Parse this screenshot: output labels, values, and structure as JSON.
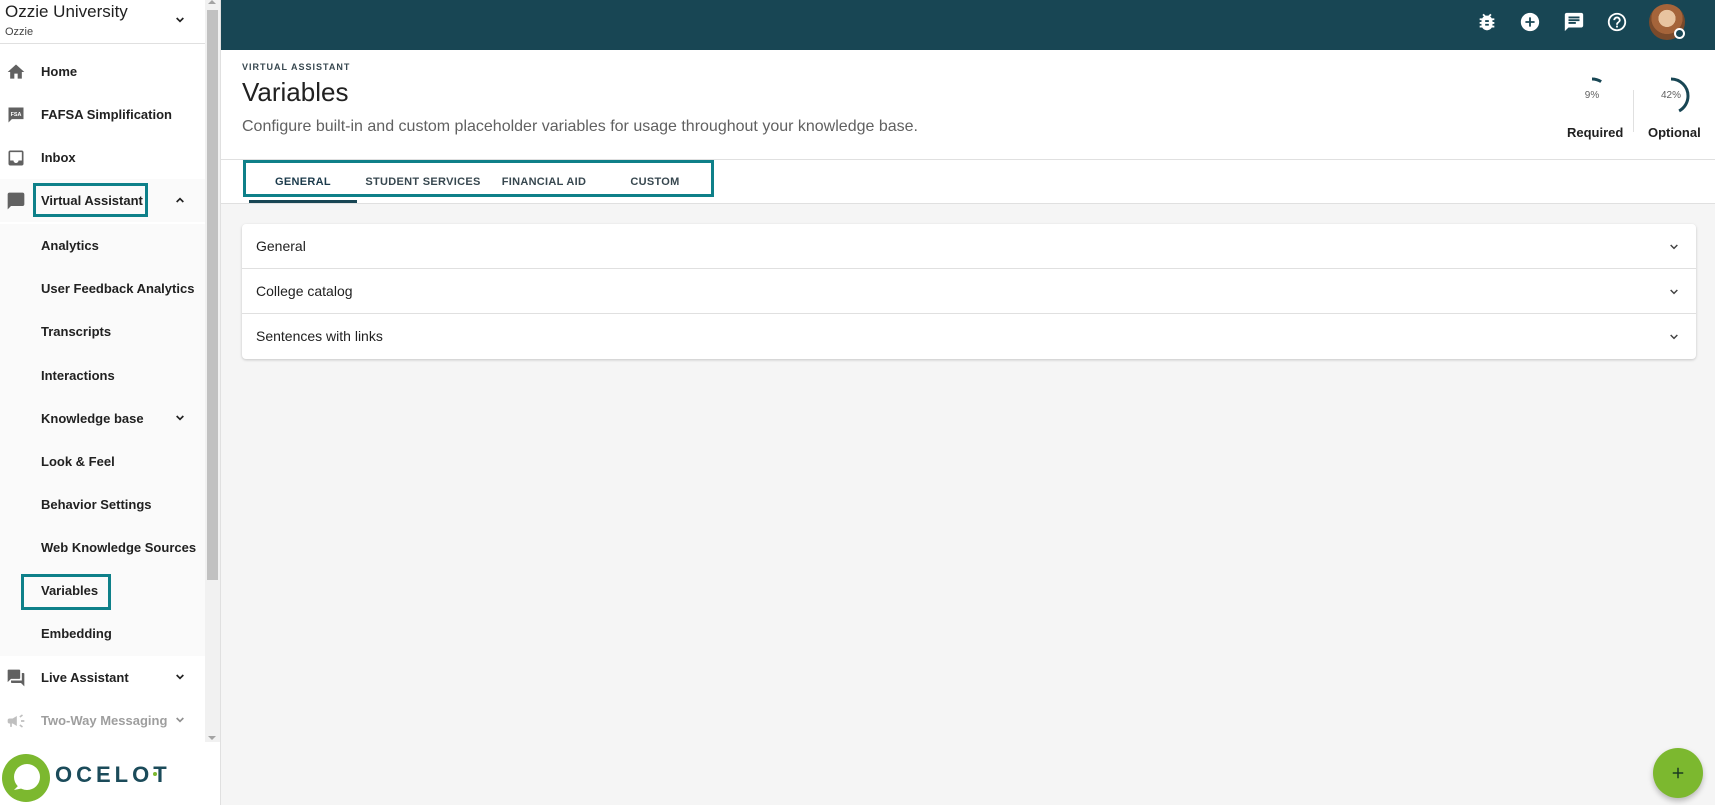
{
  "org": {
    "name": "Ozzie University",
    "sub": "Ozzie"
  },
  "sidebar": {
    "items": [
      {
        "label": "Home",
        "icon": "home-icon"
      },
      {
        "label": "FAFSA Simplification",
        "icon": "fsa-icon",
        "icon_text": "FSA"
      },
      {
        "label": "Inbox",
        "icon": "inbox-icon"
      },
      {
        "label": "Virtual Assistant",
        "icon": "chat-icon"
      },
      {
        "label": "Live Assistant",
        "icon": "forum-icon"
      },
      {
        "label": "Two-Way Messaging",
        "icon": "megaphone-icon"
      }
    ],
    "subitems": [
      {
        "label": "Analytics"
      },
      {
        "label": "User Feedback Analytics"
      },
      {
        "label": "Transcripts"
      },
      {
        "label": "Interactions"
      },
      {
        "label": "Knowledge base"
      },
      {
        "label": "Look & Feel"
      },
      {
        "label": "Behavior Settings"
      },
      {
        "label": "Web Knowledge Sources"
      },
      {
        "label": "Variables"
      },
      {
        "label": "Embedding"
      }
    ]
  },
  "logo": {
    "text": "OCELOT"
  },
  "header": {
    "eyebrow": "VIRTUAL ASSISTANT",
    "title": "Variables",
    "description": "Configure built-in and custom placeholder variables for usage throughout your knowledge base."
  },
  "progress": {
    "required": {
      "value": "9%",
      "label": "Required",
      "fraction": 0.09
    },
    "optional": {
      "value": "42%",
      "label": "Optional",
      "fraction": 0.42
    }
  },
  "tabs": [
    {
      "label": "GENERAL",
      "active": true
    },
    {
      "label": "STUDENT SERVICES"
    },
    {
      "label": "FINANCIAL AID"
    },
    {
      "label": "CUSTOM"
    }
  ],
  "accordion": [
    {
      "label": "General"
    },
    {
      "label": "College catalog"
    },
    {
      "label": "Sentences with links"
    }
  ],
  "colors": {
    "topbar": "#184654",
    "highlight": "#0e8089",
    "fab": "#7cb82f"
  }
}
